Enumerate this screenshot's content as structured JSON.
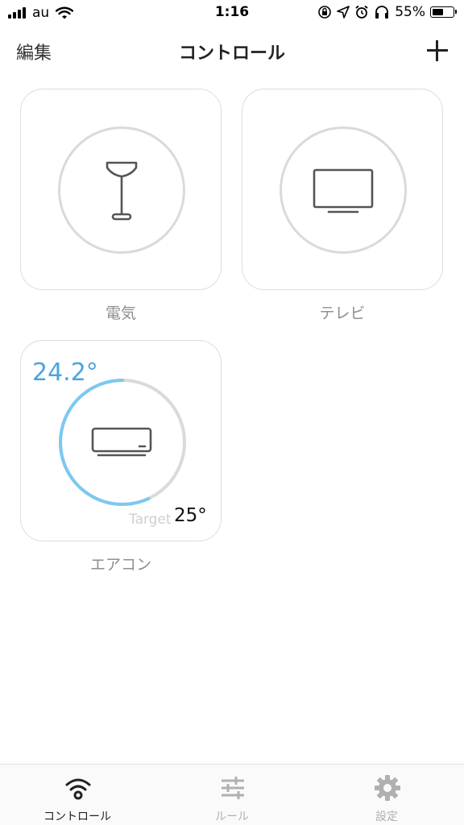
{
  "status_bar": {
    "carrier": "au",
    "time": "1:16",
    "battery_percent_label": "55%",
    "battery_level": 0.55
  },
  "nav": {
    "edit_label": "編集",
    "title": "コントロール"
  },
  "devices": [
    {
      "label": "電気",
      "icon": "floor-lamp-icon"
    },
    {
      "label": "テレビ",
      "icon": "tv-icon"
    },
    {
      "label": "エアコン",
      "icon": "air-conditioner-icon",
      "current_temp": "24.2°",
      "target_label": "Target",
      "target_temp": "25°",
      "accent_color": "#7cc8f2"
    }
  ],
  "tabs": [
    {
      "label": "コントロール",
      "icon": "wifi-icon",
      "active": true
    },
    {
      "label": "ルール",
      "icon": "sliders-icon",
      "active": false
    },
    {
      "label": "設定",
      "icon": "gear-icon",
      "active": false
    }
  ]
}
